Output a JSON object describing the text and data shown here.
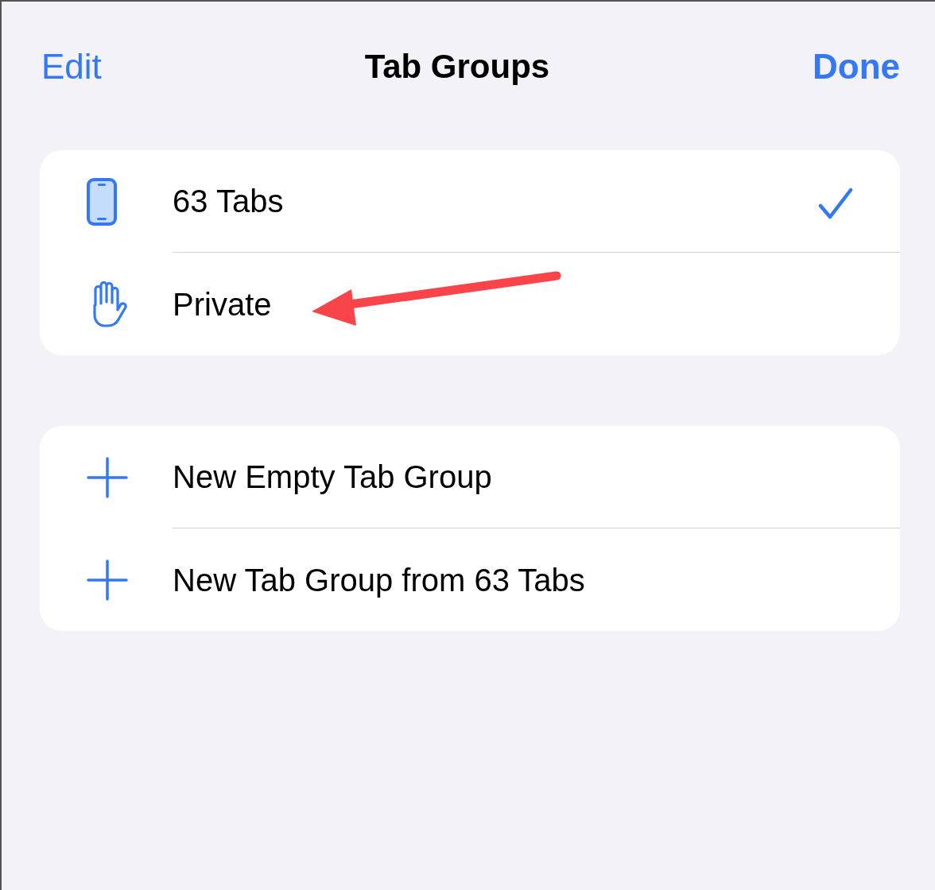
{
  "header": {
    "left_button": "Edit",
    "title": "Tab Groups",
    "right_button": "Done"
  },
  "groups": [
    {
      "kind": "device",
      "label": "63 Tabs",
      "selected": true
    },
    {
      "kind": "private",
      "label": "Private",
      "selected": false
    }
  ],
  "actions": [
    {
      "kind": "add",
      "label": "New Empty Tab Group"
    },
    {
      "kind": "add",
      "label": "New Tab Group from 63 Tabs"
    }
  ],
  "annotation": {
    "kind": "arrow"
  }
}
